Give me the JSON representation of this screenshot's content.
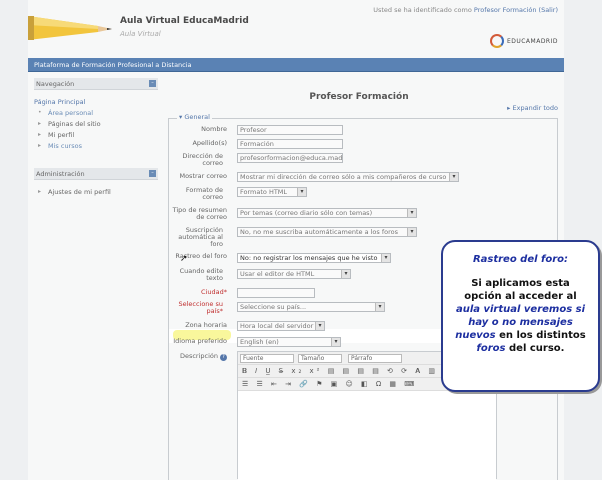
{
  "header": {
    "site_title": "Aula Virtual EducaMadrid",
    "site_subtitle": "Aula Virtual",
    "login_prefix": "Usted se ha identificado como",
    "login_user": "Profesor Formación",
    "logout": "(Salir)",
    "logo_text": "EDUCAMADRID"
  },
  "navbar": {
    "breadcrumb": "Plataforma de Formación Profesional a Distancia"
  },
  "navigation": {
    "title": "Navegación",
    "home": "Página Principal",
    "items": [
      "Área personal",
      "Páginas del sitio",
      "Mi perfil",
      "Mis cursos"
    ]
  },
  "admin": {
    "title": "Administración",
    "items": [
      "Ajustes de mi perfil"
    ]
  },
  "main": {
    "title": "Profesor Formación",
    "expand_all": "Expandir todo",
    "legend": "General"
  },
  "form": {
    "nombre_label": "Nombre",
    "nombre_value": "Profesor",
    "apellidos_label": "Apellido(s)",
    "apellidos_value": "Formación",
    "email_label": "Dirección de correo",
    "email_value": "profesorformacion@educa.mad",
    "mostrar_label": "Mostrar correo",
    "mostrar_value": "Mostrar mi dirección de correo sólo a mis compañeros de curso",
    "formato_label": "Formato de correo",
    "formato_value": "Formato HTML",
    "resumen_label": "Tipo de resumen de correo",
    "resumen_value": "Por temas (correo diario sólo con temas)",
    "suscripcion_label": "Suscripción automática al foro",
    "suscripcion_value": "No, no me suscriba automáticamente a los foros",
    "rastreo_label": "Rastreo del foro",
    "rastreo_value": "No: no registrar los mensajes que he visto",
    "editor_label": "Cuando edite texto",
    "editor_value": "Usar el editor de HTML",
    "ciudad_label": "Ciudad*",
    "pais_label": "Seleccione su país*",
    "pais_value": "Seleccione su país...",
    "zona_label": "Zona horaria",
    "zona_value": "Hora local del servidor",
    "idioma_label": "Idioma preferido",
    "idioma_value": "English (en)",
    "descripcion_label": "Descripción",
    "font_value": "Fuente",
    "size_value": "Tamaño",
    "para_value": "Párrafo"
  },
  "overlay": {
    "title": "Rastreo del foro:",
    "t1": "Si aplicamos esta opción al acceder al",
    "t2": "aula virtual veremos si hay o no mensajes nuevos",
    "t3": "en los distintos",
    "t4": "foros",
    "t5": "del curso."
  }
}
